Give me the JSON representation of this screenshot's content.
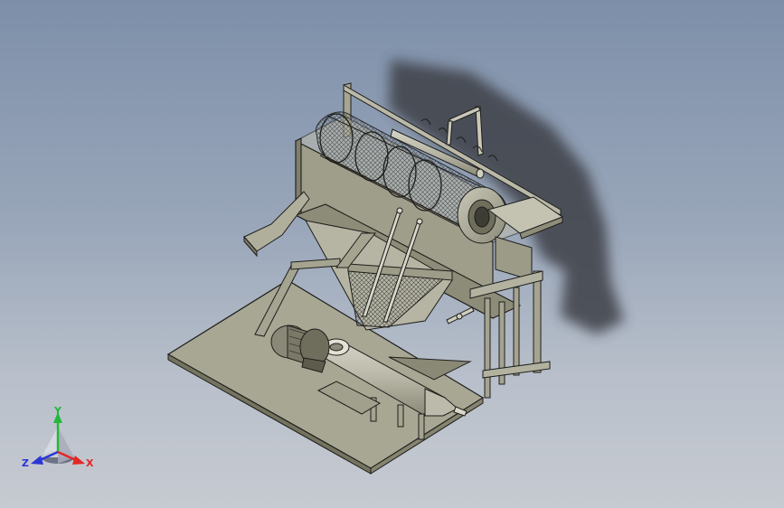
{
  "colors": {
    "background_top": "#7d8fa9",
    "background_bottom": "#c6cad1",
    "part_fill": "#a9a895",
    "part_edge": "#1e1e1c",
    "axis_x": "#e32626",
    "axis_y": "#22b83a",
    "axis_z": "#2a36d6"
  },
  "triad": {
    "x_label": "X",
    "y_label": "Y",
    "z_label": "Z"
  }
}
